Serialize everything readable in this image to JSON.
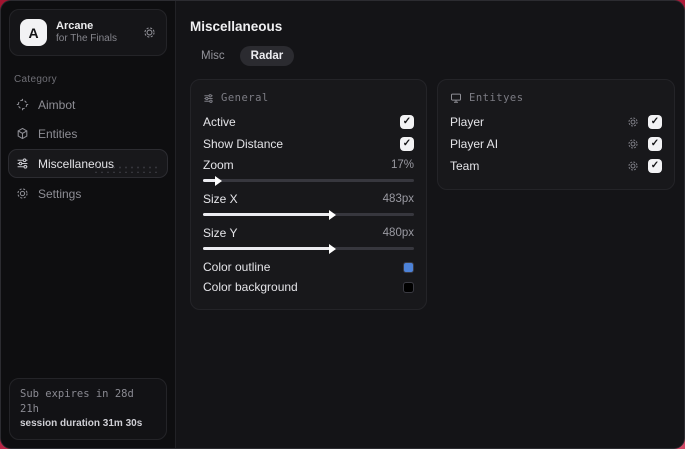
{
  "app": {
    "title": "Arcane",
    "subtitle": "for The Finals",
    "avatar_letter": "A"
  },
  "sidebar": {
    "category_label": "Category",
    "items": [
      {
        "label": "Aimbot"
      },
      {
        "label": "Entities"
      },
      {
        "label": "Miscellaneous"
      },
      {
        "label": "Settings"
      }
    ],
    "footer": {
      "sub_expires": "Sub expires in 28d 21h",
      "session_duration": "session duration 31m 30s"
    }
  },
  "main": {
    "page_title": "Miscellaneous",
    "tabs": [
      {
        "label": "Misc",
        "active": false
      },
      {
        "label": "Radar",
        "active": true
      }
    ],
    "panels": {
      "general": {
        "title": "General",
        "toggles": [
          {
            "label": "Active",
            "checked": true
          },
          {
            "label": "Show Distance",
            "checked": true
          }
        ],
        "sliders": [
          {
            "label": "Zoom",
            "value": "17%",
            "percent": 6
          },
          {
            "label": "Size X",
            "value": "483px",
            "percent": 60
          },
          {
            "label": "Size Y",
            "value": "480px",
            "percent": 60
          }
        ],
        "colors": [
          {
            "label": "Color outline",
            "swatch": "#4d82d8"
          },
          {
            "label": "Color background",
            "swatch": "#000000"
          }
        ]
      },
      "entities": {
        "title": "Entityes",
        "rows": [
          {
            "label": "Player",
            "checked": true
          },
          {
            "label": "Player AI",
            "checked": true
          },
          {
            "label": "Team",
            "checked": true
          }
        ]
      }
    }
  },
  "icons": {
    "check": "✓"
  },
  "colors": {
    "backdrop_red": "#b21d3d",
    "panel_bg": "#18181b",
    "swatch_blue": "#4d82d8",
    "swatch_black": "#000000"
  }
}
